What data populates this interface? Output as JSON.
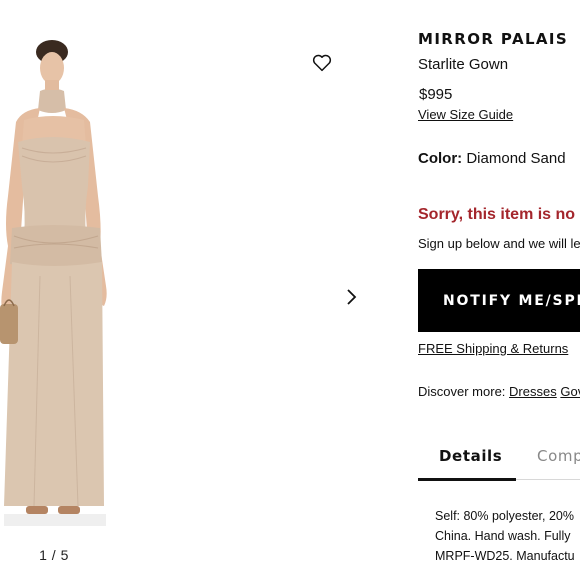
{
  "gallery": {
    "image_alt": "Model wearing strapless sand-colored gown",
    "counter": "1 / 5",
    "wishlist_icon": "heart-outline-icon",
    "next_icon": "chevron-right-icon"
  },
  "product": {
    "brand": "MIRROR PALAIS",
    "name": "Starlite Gown",
    "price": "$995",
    "size_guide_link": "View Size Guide",
    "color_label": "Color:",
    "color_value": "Diamond Sand",
    "out_of_stock_message": "Sorry, this item is no",
    "signup_message": "Sign up below and we will le",
    "notify_button": "NOTIFY ME/SPE",
    "shipping_link": "FREE Shipping & Returns",
    "discover_label": "Discover more:",
    "discover_links": [
      "Dresses",
      "Gov"
    ]
  },
  "tabs": [
    {
      "label": "Details",
      "active": true
    },
    {
      "label": "Comp",
      "active": false
    }
  ],
  "description_lines": [
    "Self: 80% polyester, 20%",
    "China. Hand wash. Fully",
    "MRPF-WD25. Manufactu"
  ],
  "colors": {
    "out_of_stock": "#a4262c",
    "button_bg": "#000000",
    "gown": "#d8c1ab"
  }
}
